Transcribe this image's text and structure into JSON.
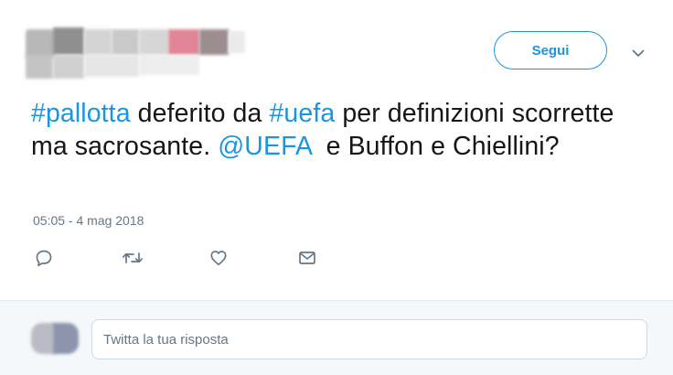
{
  "header": {
    "author_name": "",
    "follow_label": "Segui",
    "menu_icon": "chevron-down-icon",
    "colors": {
      "accent": "#1b95e0",
      "avatar_blur": [
        "#8e8e8e",
        "#b4b4b4",
        "#cdcdcd",
        "#d9d9d9",
        "#e27b8a",
        "#9a8a8e",
        "#c3c3c3",
        "#e3e3e3"
      ]
    }
  },
  "tweet": {
    "segments": [
      {
        "text": "#pallotta",
        "type": "hashtag"
      },
      {
        "text": " deferito da ",
        "type": "text"
      },
      {
        "text": "#uefa",
        "type": "hashtag"
      },
      {
        "text": " per definizioni scorrette ma sacrosante. ",
        "type": "text"
      },
      {
        "text": "@UEFA",
        "type": "mention"
      },
      {
        "text": "  e Buffon e Chiellini?",
        "type": "text"
      }
    ],
    "timestamp": "05:05 - 4 mag 2018"
  },
  "actions": [
    {
      "name": "reply",
      "icon": "reply-icon"
    },
    {
      "name": "retweet",
      "icon": "retweet-icon"
    },
    {
      "name": "like",
      "icon": "heart-icon"
    },
    {
      "name": "direct-message",
      "icon": "envelope-icon"
    }
  ],
  "reply_box": {
    "placeholder": "Twitta la tua risposta"
  }
}
